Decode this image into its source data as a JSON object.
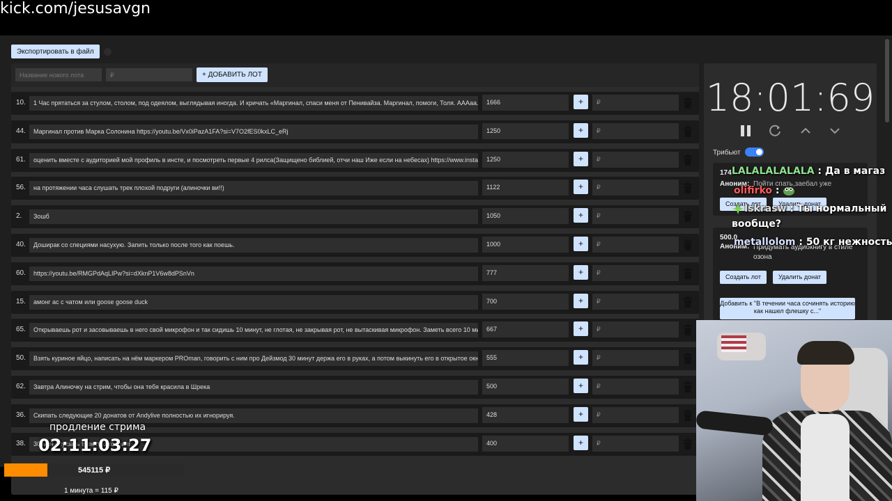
{
  "url": "kick.com/jesusavgn",
  "toolbar": {
    "export_label": "Экспортировать в файл"
  },
  "add_form": {
    "name_placeholder": "Название нового лота",
    "price_placeholder": "₽",
    "add_label": "+ ДОБАВИТЬ ЛОТ"
  },
  "lots": [
    {
      "num": "10.",
      "name": "1 Час прятаться за стулом, столом, под одеялом, выглядывая иногда. И кричать «Маргинал, спаси меня от Пенивайза. Маргинал, помоги, Толя. АААаа.",
      "amount": "1666"
    },
    {
      "num": "44.",
      "name": "Маргинал против Марка Солонина https://youtu.be/Vx0iPazA1FA?si=V7O2fES0kxLC_eRj",
      "amount": "1250"
    },
    {
      "num": "61.",
      "name": "оценить вместе с аудиторией мой профиль в инсте, и посмотреть первые 4 рилса(Защищено библией, отчи наш Иже если на небесах) https://www.instag",
      "amount": "1250"
    },
    {
      "num": "56.",
      "name": "на протяжении часа слушать трек плохой подруги (алиночки ви!!)",
      "amount": "1122"
    },
    {
      "num": "2.",
      "name": "Зошб",
      "amount": "1050"
    },
    {
      "num": "40.",
      "name": "Доширак со специями насухую. Запить только после того как поешь.",
      "amount": "1000"
    },
    {
      "num": "60.",
      "name": "https://youtu.be/RMGPdAqLIPw?si=dXknP1V6w8dPSnVn",
      "amount": "777"
    },
    {
      "num": "15.",
      "name": "амонг ас с чатом или goose goose duck",
      "amount": "700"
    },
    {
      "num": "65.",
      "name": "Открываешь рот и засовываешь в него свой микрофон и так сидишь 10 минут, не глотая, не закрывая рот, не вытаскивая микрофон. Заметь всего 10 ми",
      "amount": "667"
    },
    {
      "num": "50.",
      "name": "Взять куриное яйцо, написать на нём маркером PROman, говорить с ним про Дейзмод 30 минут держа его в руках, а потом выкинуть его в открытое окн",
      "amount": "555"
    },
    {
      "num": "62.",
      "name": "Завтра Алиночку на стрим, чтобы она тебя красила в Шрека",
      "amount": "500"
    },
    {
      "num": "36.",
      "name": "Скипать следующие 20 донатов от Andylive полностью их игнорируя.",
      "amount": "428"
    },
    {
      "num": "38.",
      "name": "30 мин слушать трек про холлинг",
      "amount": "400"
    }
  ],
  "lot_ui": {
    "plus": "+",
    "price_placeholder": "₽"
  },
  "timer": {
    "display": "18:01:69",
    "tribute_label": "Трибьют"
  },
  "donations": [
    {
      "amount": "174",
      "author": "Аноним:",
      "message": "Пойти спать,заебал уже",
      "create_label": "Создать лот",
      "delete_label": "Удалить донат"
    },
    {
      "amount": "500.0",
      "author": "Аноним:",
      "message": "Придумать аудиокнигу в стиле озона",
      "create_label": "Создать лот",
      "delete_label": "Удалить донат",
      "add_to_label": "Добавить к \"В течении часа сочинять историю как нашел флешку с...\""
    }
  ],
  "chat": [
    {
      "name": "LALALALALALA",
      "sep": " : ",
      "text": "Да в магаз"
    },
    {
      "name": "olifirko",
      "sep": " : ",
      "text": ""
    },
    {
      "name": "Iskrasw",
      "sep": " : ",
      "text": "Ты нормальный"
    },
    {
      "name": "",
      "sep": "",
      "text": "вообще?"
    },
    {
      "name": "metallolom",
      "sep": " : ",
      "text": "50 кг нежность"
    }
  ],
  "overlay": {
    "title": "продление стрима",
    "timer": "02:11:03:27",
    "total": "545115 ₽",
    "rate": "1 минута = 115 ₽",
    "progress_percent": 24
  },
  "colors": {
    "accent": "#cfe3ff",
    "progress": "#ff8c00",
    "toggle": "#3b82f6"
  }
}
